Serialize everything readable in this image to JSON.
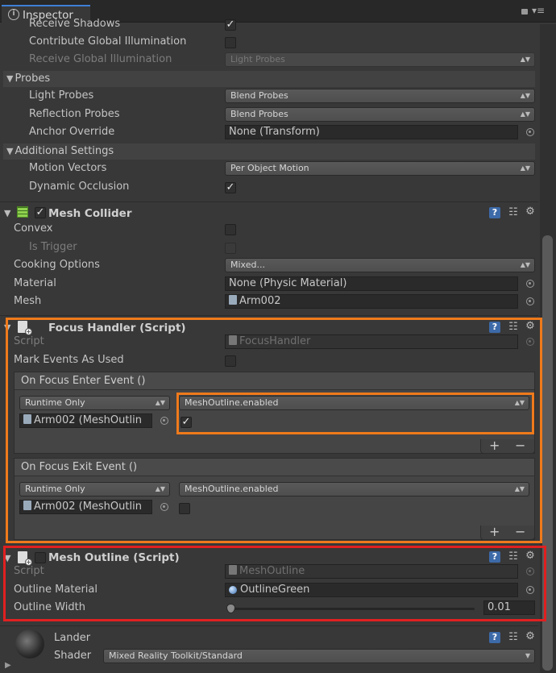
{
  "tab": {
    "title": "Inspector"
  },
  "renderer": {
    "receive_shadows_label": "Receive Shadows",
    "contribute_gi_label": "Contribute Global Illumination",
    "receive_gi_label": "Receive Global Illumination",
    "receive_gi_value": "Light Probes",
    "probes_header": "Probes",
    "light_probes_label": "Light Probes",
    "light_probes_value": "Blend Probes",
    "reflection_probes_label": "Reflection Probes",
    "reflection_probes_value": "Blend Probes",
    "anchor_override_label": "Anchor Override",
    "anchor_override_value": "None (Transform)",
    "additional_header": "Additional Settings",
    "motion_vectors_label": "Motion Vectors",
    "motion_vectors_value": "Per Object Motion",
    "dynamic_occlusion_label": "Dynamic Occlusion"
  },
  "mesh_collider": {
    "title": "Mesh Collider",
    "convex_label": "Convex",
    "is_trigger_label": "Is Trigger",
    "cooking_label": "Cooking Options",
    "cooking_value": "Mixed...",
    "material_label": "Material",
    "material_value": "None (Physic Material)",
    "mesh_label": "Mesh",
    "mesh_value": "Arm002"
  },
  "focus_handler": {
    "title": "Focus Handler (Script)",
    "script_label": "Script",
    "script_value": "FocusHandler",
    "mark_events_label": "Mark Events As Used",
    "enter_event": {
      "title": "On Focus Enter Event ()",
      "mode": "Runtime Only",
      "function": "MeshOutline.enabled",
      "object": "Arm002 (MeshOutlin"
    },
    "exit_event": {
      "title": "On Focus Exit Event ()",
      "mode": "Runtime Only",
      "function": "MeshOutline.enabled",
      "object": "Arm002 (MeshOutlin"
    },
    "plus": "+",
    "minus": "−"
  },
  "mesh_outline": {
    "title": "Mesh Outline (Script)",
    "script_label": "Script",
    "script_value": "MeshOutline",
    "material_label": "Outline Material",
    "material_value": "OutlineGreen",
    "width_label": "Outline Width",
    "width_value": "0.01"
  },
  "material": {
    "name": "Lander",
    "shader_label": "Shader",
    "shader_value": "Mixed Reality Toolkit/Standard"
  },
  "colors": {
    "highlight_orange": "#ef7a1b",
    "highlight_red": "#e02020",
    "help_blue": "#3d6aa8"
  }
}
